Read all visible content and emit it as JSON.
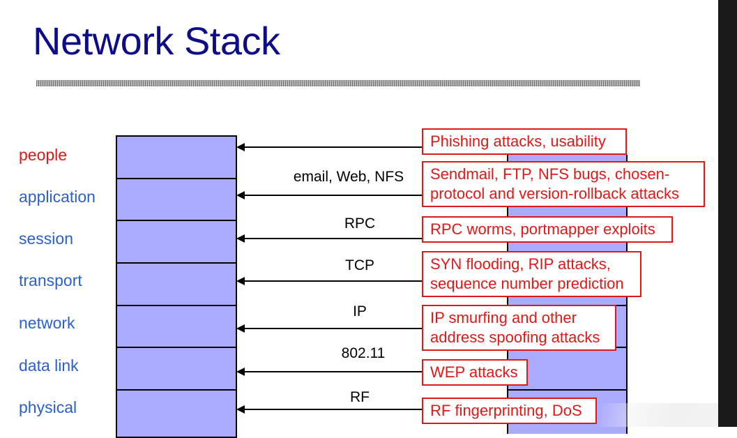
{
  "slide": {
    "title": "Network Stack"
  },
  "layers": [
    {
      "name": "people",
      "color": "#e01818"
    },
    {
      "name": "application",
      "color": "#2a5fd0"
    },
    {
      "name": "session",
      "color": "#2a5fd0"
    },
    {
      "name": "transport",
      "color": "#2a5fd0"
    },
    {
      "name": "network",
      "color": "#2a5fd0"
    },
    {
      "name": "data link",
      "color": "#2a5fd0"
    },
    {
      "name": "physical",
      "color": "#2a5fd0"
    }
  ],
  "protocols": {
    "application": "email, Web, NFS",
    "session": "RPC",
    "transport": "TCP",
    "network": "IP",
    "data_link": "802.11",
    "physical": "RF"
  },
  "attacks": {
    "people": [
      "Phishing attacks, usability"
    ],
    "application": [
      "Sendmail, FTP, NFS bugs, chosen-",
      "protocol and version-rollback attacks"
    ],
    "session": [
      "RPC worms, portmapper exploits"
    ],
    "transport": [
      "SYN flooding, RIP attacks,",
      "sequence number prediction"
    ],
    "network": [
      "IP smurfing and other",
      "address spoofing attacks"
    ],
    "data_link": [
      "WEP attacks"
    ],
    "physical": [
      "RF fingerprinting, DoS"
    ]
  },
  "colors": {
    "title": "#0d0d8a",
    "layer_label": "#2a5fd0",
    "people_label": "#e01818",
    "attack_border": "#e01818",
    "stack_fill": "#aaaaff"
  }
}
